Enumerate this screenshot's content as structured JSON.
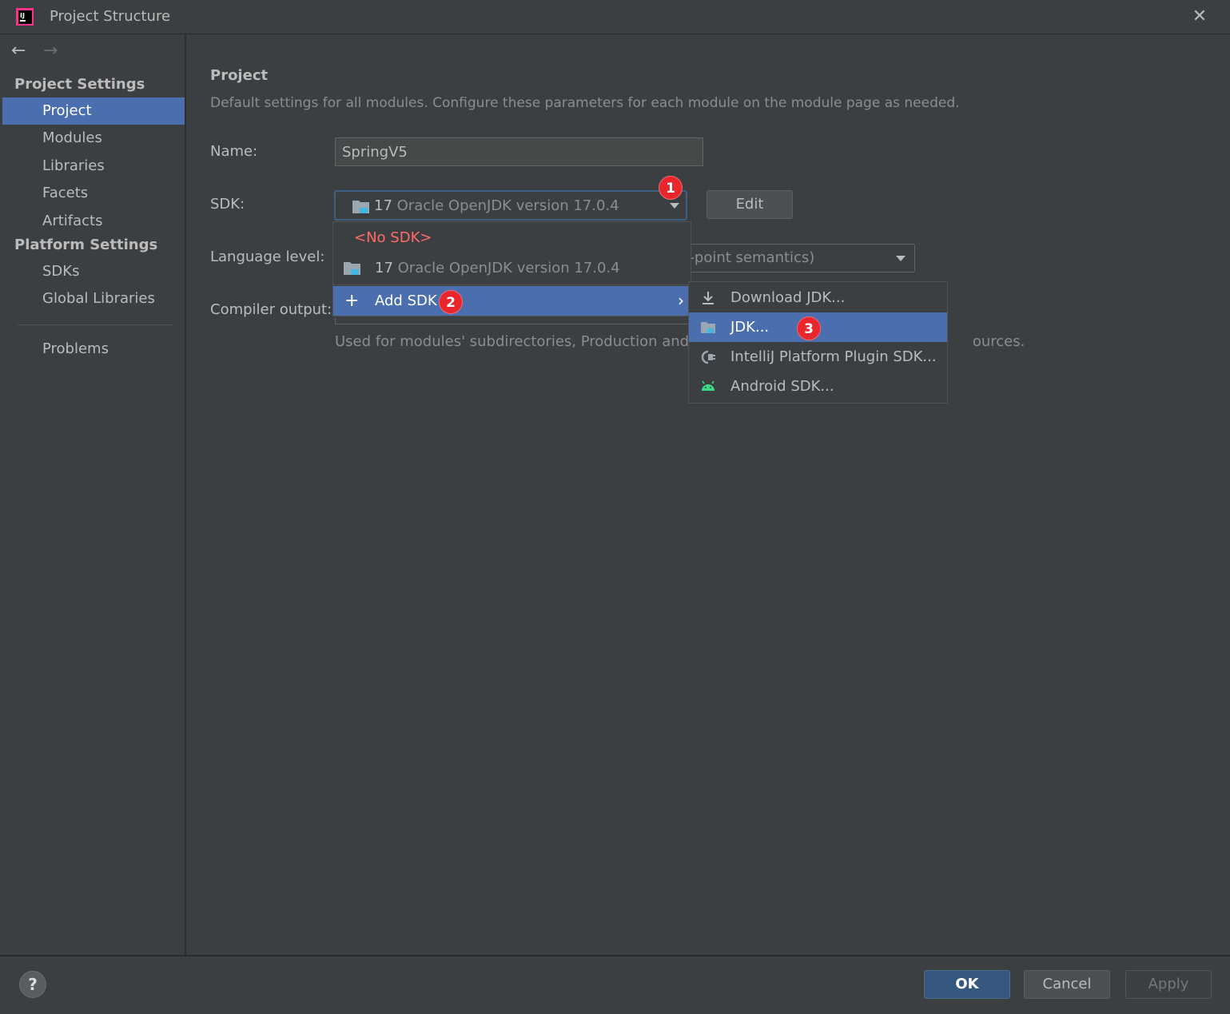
{
  "window": {
    "title": "Project Structure"
  },
  "sidebar": {
    "section_project": "Project Settings",
    "project_items": [
      "Project",
      "Modules",
      "Libraries",
      "Facets",
      "Artifacts"
    ],
    "section_platform": "Platform Settings",
    "platform_items": [
      "SDKs",
      "Global Libraries"
    ],
    "problems": "Problems",
    "selected": "Project"
  },
  "content": {
    "title": "Project",
    "description": "Default settings for all modules. Configure these parameters for each module on the module page as needed.",
    "name_label": "Name:",
    "name_value": "SpringV5",
    "sdk_label": "SDK:",
    "sdk_value_version": "17",
    "sdk_value_name": "Oracle OpenJDK version 17.0.4",
    "edit_button": "Edit",
    "language_label": "Language level:",
    "language_value": "g-point semantics)",
    "compiler_label": "Compiler output:",
    "compiler_hint_left": "Used for modules' subdirectories, Production and Te",
    "compiler_hint_right": "ources."
  },
  "sdk_popup": {
    "no_sdk": "<No SDK>",
    "jdk_version": "17",
    "jdk_name": "Oracle OpenJDK version 17.0.4",
    "add_sdk": "Add SDK"
  },
  "submenu": {
    "items": [
      "Download JDK...",
      "JDK...",
      "IntelliJ Platform Plugin SDK...",
      "Android SDK..."
    ],
    "selected": "JDK..."
  },
  "badges": [
    "1",
    "2",
    "3"
  ],
  "footer": {
    "ok": "OK",
    "cancel": "Cancel",
    "apply": "Apply",
    "help": "?"
  },
  "colors": {
    "accent": "#4b6eaf",
    "badge": "#e8262b",
    "no_sdk": "#ff6b68",
    "android": "#3ddc84"
  }
}
